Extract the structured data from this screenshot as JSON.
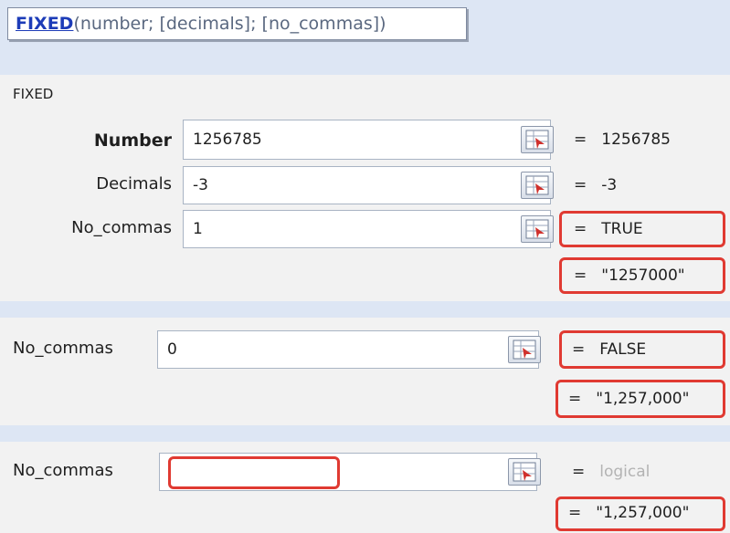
{
  "tooltip": {
    "function_name": "FIXED",
    "arguments": "(number; [decimals]; [no_commas])"
  },
  "dialog1": {
    "function_name": "FIXED",
    "args": [
      {
        "label": "Number",
        "value": "1256785",
        "result": "1256785"
      },
      {
        "label": "Decimals",
        "value": "-3",
        "result": "-3"
      },
      {
        "label": "No_commas",
        "value": "1",
        "result": "TRUE"
      }
    ],
    "formula_result": "\"1257000\""
  },
  "dialog2": {
    "label": "No_commas",
    "value": "0",
    "result": "FALSE",
    "formula_result": "\"1,257,000\""
  },
  "dialog3": {
    "label": "No_commas",
    "value": "",
    "result": "logical",
    "formula_result": "\"1,257,000\""
  },
  "equals_sign": "=",
  "icons": {
    "range_selector": "collapse-dialog-icon"
  },
  "colors": {
    "highlight": "#e03a32",
    "background": "#dde6f4",
    "panel": "#f2f2f2",
    "function_link": "#1d3cb8"
  }
}
